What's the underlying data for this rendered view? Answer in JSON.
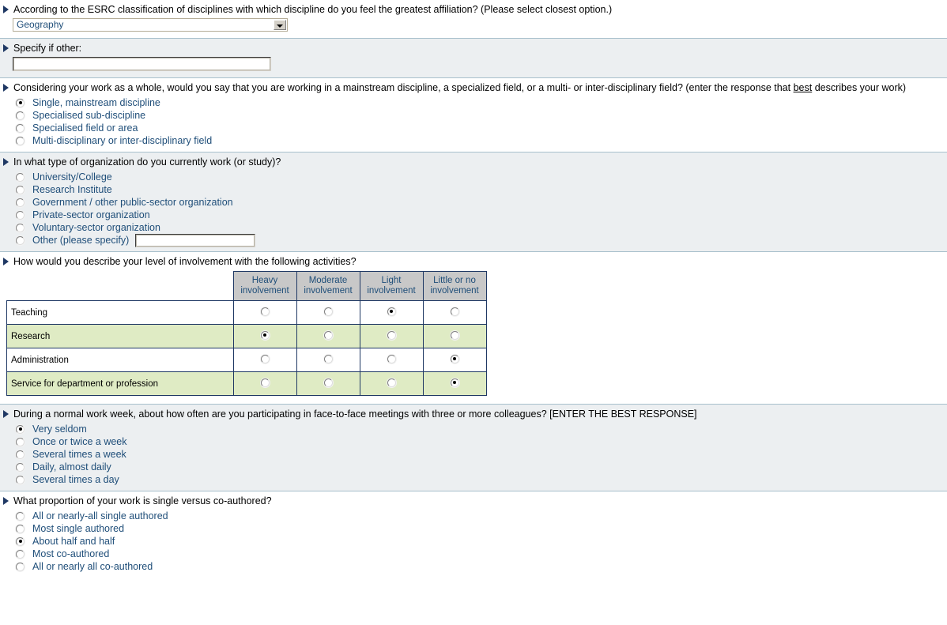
{
  "colors": {
    "shaded_bg": "#eceff1",
    "white_bg": "#ffffff",
    "divider": "#a8c0cc",
    "grid_border": "#1f3864",
    "grid_header_bg": "#c8c8c8",
    "grid_row_green": "#dfebc4",
    "option_text": "#1f4e79",
    "bullet": "#1f3864"
  },
  "sections": [
    {
      "id": "discipline-affiliation",
      "question": "According to the ESRC classification of disciplines with which discipline do you feel the greatest affiliation? (Please select closest option.)",
      "select": {
        "value": "Geography",
        "options": [
          "Geography"
        ]
      }
    },
    {
      "id": "specify-other",
      "question": "Specify if other:",
      "input": {
        "value": "",
        "placeholder": ""
      }
    },
    {
      "id": "work-scope",
      "question_part1": "Considering your work as a whole, would you say that you are working in a mainstream discipline, a specialized field, or a multi- or inter-disciplinary field? (enter the response that ",
      "question_emphasis": "best",
      "question_part2": " describes your work)",
      "options": [
        {
          "label": "Single, mainstream discipline",
          "selected": false
        },
        {
          "label": "Specialised sub-discipline",
          "selected": false
        },
        {
          "label": "Specialised field or area",
          "selected": false
        },
        {
          "label": "Multi-disciplinary or inter-disciplinary field",
          "selected": true
        }
      ]
    },
    {
      "id": "organization-type",
      "question": "In what type of organization do you currently work (or study)?",
      "options": [
        {
          "label": "University/College",
          "selected": true
        },
        {
          "label": "Research Institute",
          "selected": false
        },
        {
          "label": "Government / other public-sector organization",
          "selected": false
        },
        {
          "label": "Private-sector organization",
          "selected": false
        },
        {
          "label": "Voluntary-sector organization",
          "selected": false
        },
        {
          "label": "Other (please specify)",
          "selected": false,
          "has_input": true,
          "input_value": ""
        }
      ]
    },
    {
      "id": "involvement-level",
      "question": "How would you describe your level of involvement with the following activities?",
      "grid": {
        "columns": [
          "Heavy involvement",
          "Moderate involvement",
          "Light involvement",
          "Little or no involvement"
        ],
        "rows": [
          {
            "label": "Teaching",
            "selected_index": 2,
            "shade": "white"
          },
          {
            "label": "Research",
            "selected_index": 0,
            "shade": "green"
          },
          {
            "label": "Administration",
            "selected_index": 3,
            "shade": "white"
          },
          {
            "label": "Service for department or profession",
            "selected_index": 3,
            "shade": "green"
          }
        ]
      }
    },
    {
      "id": "meeting-frequency",
      "question": "During a normal work week, about how often are you participating in face-to-face meetings with three or more colleagues? [ENTER THE BEST RESPONSE]",
      "options": [
        {
          "label": "Very seldom",
          "selected": true
        },
        {
          "label": "Once or twice a week",
          "selected": false
        },
        {
          "label": "Several times a week",
          "selected": false
        },
        {
          "label": "Daily, almost daily",
          "selected": false
        },
        {
          "label": "Several times a day",
          "selected": false
        }
      ]
    },
    {
      "id": "authorship-proportion",
      "question": "What proportion of your work is single versus co-authored?",
      "options": [
        {
          "label": "All or nearly-all single authored",
          "selected": false
        },
        {
          "label": "Most single authored",
          "selected": false
        },
        {
          "label": "About half and half",
          "selected": true
        },
        {
          "label": "Most co-authored",
          "selected": false
        },
        {
          "label": "All or nearly all co-authored",
          "selected": false
        }
      ]
    }
  ]
}
